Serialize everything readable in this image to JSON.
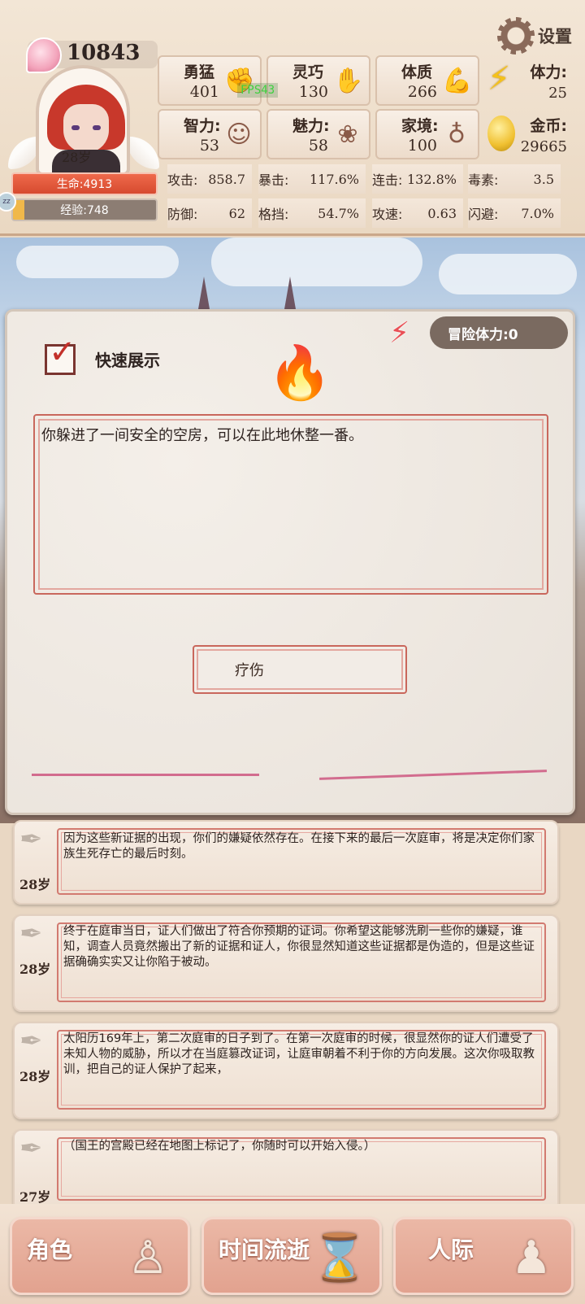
{
  "header": {
    "settings_label": "设置",
    "soul_points": "10843",
    "age": "28岁",
    "hp": "生命:4913",
    "exp": "经验:748",
    "exp_fraction": 0.08,
    "fps": "FPS43",
    "attributes": [
      {
        "name": "勇猛",
        "value": "401",
        "icon": "fist-icon"
      },
      {
        "name": "灵巧",
        "value": "130",
        "icon": "hand-icon"
      },
      {
        "name": "体质",
        "value": "266",
        "icon": "muscle-arm-icon"
      },
      {
        "name": "智力:",
        "value": "53",
        "icon": "brain-head-icon"
      },
      {
        "name": "魅力:",
        "value": "58",
        "icon": "flower-icon"
      },
      {
        "name": "家境:",
        "value": "100",
        "icon": "money-hand-icon"
      }
    ],
    "stamina": {
      "label": "体力:",
      "value": "25",
      "icon": "lightning-icon"
    },
    "gold": {
      "label": "金币:",
      "value": "29665",
      "icon": "gold-coin-icon"
    },
    "combat": [
      {
        "label": "攻击:",
        "value": "858.7"
      },
      {
        "label": "暴击:",
        "value": "117.6%"
      },
      {
        "label": "连击:",
        "value": "132.8%"
      },
      {
        "label": "毒素:",
        "value": "3.5"
      },
      {
        "label": "防御:",
        "value": "62"
      },
      {
        "label": "格挡:",
        "value": "54.7%"
      },
      {
        "label": "攻速:",
        "value": "0.63"
      },
      {
        "label": "闪避:",
        "value": "7.0%"
      }
    ]
  },
  "dialog": {
    "adventure_stamina": "冒险体力:0",
    "quick_show_label": "快速展示",
    "quick_show_checked": true,
    "story_text": "你躲进了一间安全的空房，可以在此地休整一番。",
    "action_button": "疗伤"
  },
  "log": [
    {
      "age": "28岁",
      "text": "因为这些新证据的出现，你们的嫌疑依然存在。在接下来的最后一次庭审，将是决定你们家族生死存亡的最后时刻。"
    },
    {
      "age": "28岁",
      "text": "终于在庭审当日，证人们做出了符合你预期的证词。你希望这能够洗刷一些你的嫌疑，谁知，调查人员竟然搬出了新的证据和证人，你很显然知道这些证据都是伪造的，但是这些证据确确实实又让你陷于被动。"
    },
    {
      "age": "28岁",
      "text": "太阳历169年上，第二次庭审的日子到了。在第一次庭审的时候，很显然你的证人们遭受了未知人物的威胁，所以才在当庭篡改证词，让庭审朝着不利于你的方向发展。这次你吸取教训，把自己的证人保护了起来，"
    },
    {
      "age": "27岁",
      "text": "（国王的宫殿已经在地图上标记了，你随时可以开始入侵。）"
    }
  ],
  "nav": [
    {
      "label": "角色",
      "icon": "character-bust-icon"
    },
    {
      "label": "时间流逝",
      "icon": "hourglass-icon"
    },
    {
      "label": "人际",
      "icon": "people-icon"
    }
  ]
}
